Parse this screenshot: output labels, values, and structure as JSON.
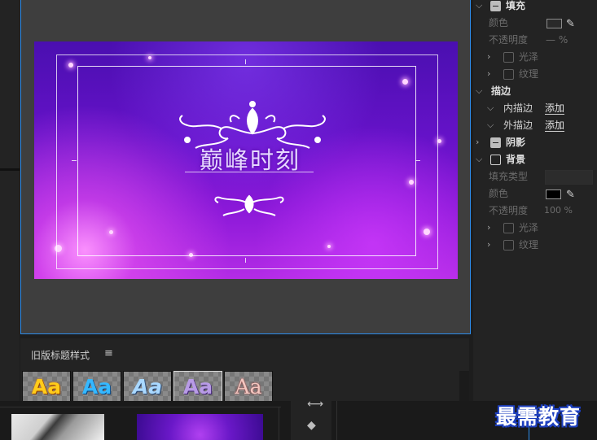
{
  "preview": {
    "title_text": "巅峰时刻"
  },
  "styles_panel": {
    "title": "旧版标题样式",
    "menu_icon": "hamburger-icon",
    "swatches": [
      {
        "label": "Aa",
        "style": "gold-bevel"
      },
      {
        "label": "Aa",
        "style": "blue-gloss"
      },
      {
        "label": "Aa",
        "style": "light-blue-italic"
      },
      {
        "label": "Aa",
        "style": "purple-emboss",
        "selected": true
      },
      {
        "label": "Aa",
        "style": "pink-serif"
      }
    ]
  },
  "properties": {
    "fill": {
      "label": "填充",
      "color_label": "颜色",
      "opacity_label": "不透明度",
      "opacity_value": "— %",
      "sheen_label": "光泽",
      "texture_label": "纹理"
    },
    "stroke": {
      "label": "描边",
      "inner_label": "内描边",
      "inner_action": "添加",
      "outer_label": "外描边",
      "outer_action": "添加"
    },
    "shadow": {
      "label": "阴影"
    },
    "background": {
      "label": "背景",
      "fill_type_label": "填充类型",
      "color_label": "颜色",
      "color_value": "#000000",
      "opacity_label": "不透明度",
      "opacity_value": "100 %",
      "sheen_label": "光泽",
      "texture_label": "纹理"
    }
  },
  "watermark": "最需教育",
  "colors": {
    "accent_blue": "#2d8ceb",
    "panel_bg": "#232323",
    "preview_bg": "#3e3e3e"
  }
}
